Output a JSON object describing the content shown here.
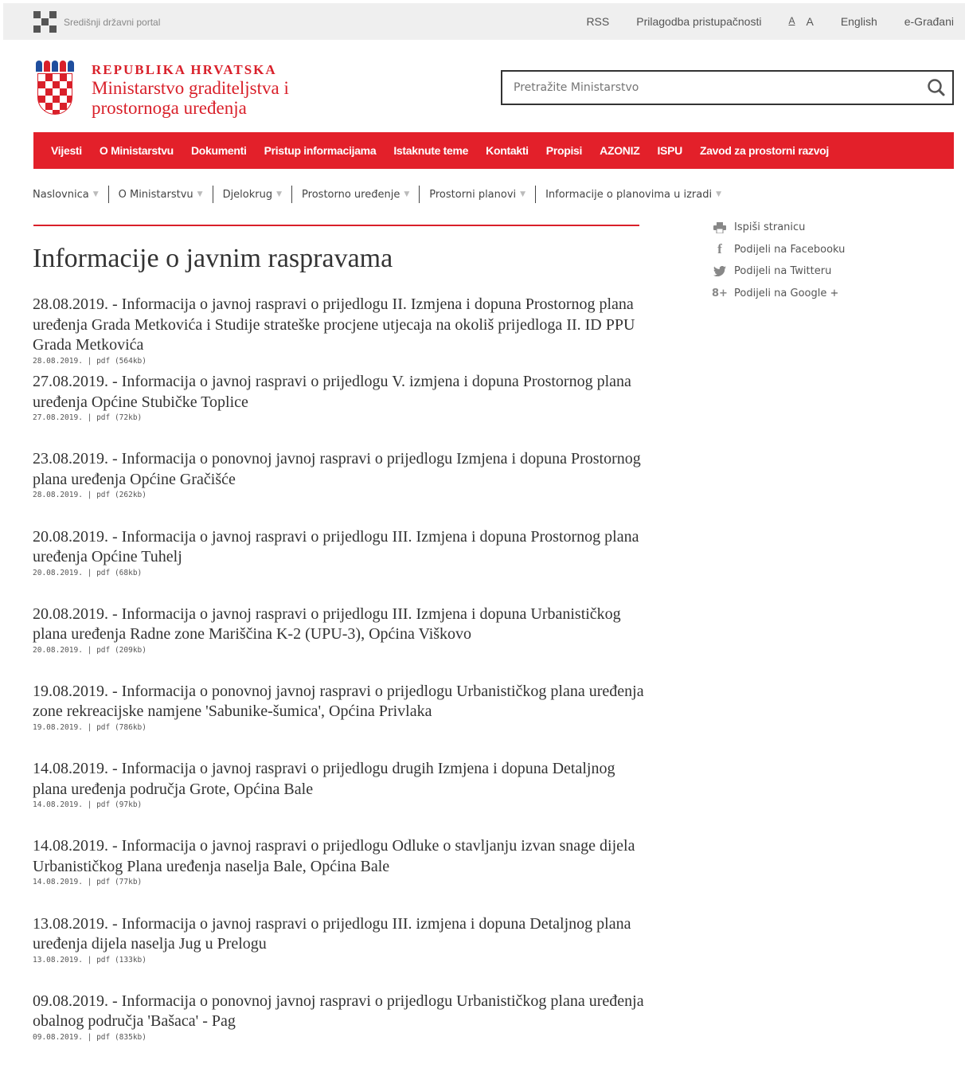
{
  "topbar": {
    "portal_name": "Središnji državni portal",
    "links": {
      "rss": "RSS",
      "accessibility": "Prilagodba pristupačnosti",
      "font_small": "A",
      "font_large": "A",
      "english": "English",
      "egradjani": "e-Građani"
    }
  },
  "header": {
    "republic": "REPUBLIKA HRVATSKA",
    "ministry": "Ministarstvo graditeljstva i prostornoga uređenja",
    "search_placeholder": "Pretražite Ministarstvo"
  },
  "nav": {
    "items": [
      "Vijesti",
      "O Ministarstvu",
      "Dokumenti",
      "Pristup informacijama",
      "Istaknute teme",
      "Kontakti",
      "Propisi",
      "AZONIZ",
      "ISPU",
      "Zavod za prostorni razvoj"
    ]
  },
  "breadcrumb": [
    "Naslovnica",
    "O Ministarstvu",
    "Djelokrug",
    "Prostorno uređenje",
    "Prostorni planovi",
    "Informacije o planovima u izradi"
  ],
  "page": {
    "title": "Informacije o javnim raspravama"
  },
  "items": [
    {
      "text": "28.08.2019. - Informacija o javnoj raspravi o prijedlogu II. Izmjena i dopuna Prostornog plana uređenja Grada Metkovića i Studije strateške procjene utjecaja na okoliš prijedloga II. ID PPU Grada Metkovića",
      "meta": "28.08.2019. | pdf (564kb)"
    },
    {
      "text": "27.08.2019. - Informacija o javnoj raspravi o prijedlogu V. izmjena i dopuna Prostornog plana uređenja Općine Stubičke Toplice",
      "meta": "27.08.2019. | pdf (72kb)"
    },
    {
      "text": "23.08.2019. - Informacija o ponovnoj javnoj raspravi o prijedlogu Izmjena i dopuna Prostornog plana uređenja Općine Gračišće",
      "meta": "28.08.2019. | pdf (262kb)"
    },
    {
      "text": "20.08.2019. - Informacija o javnoj raspravi o prijedlogu III. Izmjena i dopuna Prostornog plana uređenja Općine Tuhelj",
      "meta": "20.08.2019. | pdf (68kb)"
    },
    {
      "text": "20.08.2019. - Informacija o javnoj raspravi o prijedlogu III. Izmjena i dopuna Urbanističkog plana uređenja Radne zone Mariščina K-2 (UPU-3), Općina Viškovo",
      "meta": "20.08.2019. | pdf (209kb)"
    },
    {
      "text": "19.08.2019. - Informacija o ponovnoj javnoj raspravi o prijedlogu Urbanističkog plana uređenja zone rekreacijske namjene 'Sabunike-šumica', Općina Privlaka",
      "meta": "19.08.2019. | pdf (786kb)"
    },
    {
      "text": "14.08.2019. - Informacija o javnoj raspravi o prijedlogu drugih Izmjena i dopuna Detaljnog plana uređenja područja Grote, Općina Bale",
      "meta": "14.08.2019. | pdf (97kb)"
    },
    {
      "text": "14.08.2019. - Informacija o javnoj raspravi o prijedlogu Odluke o stavljanju izvan snage dijela Urbanističkog Plana uređenja naselja Bale, Općina Bale",
      "meta": "14.08.2019. | pdf (77kb)"
    },
    {
      "text": "13.08.2019. - Informacija o javnoj raspravi o prijedlogu III. izmjena i dopuna Detaljnog plana uređenja dijela naselja Jug u Prelogu",
      "meta": "13.08.2019. | pdf (133kb)"
    },
    {
      "text": "09.08.2019. - Informacija o ponovnoj javnoj raspravi o prijedlogu Urbanističkog plana uređenja obalnog područja 'Bašaca' - Pag",
      "meta": "09.08.2019. | pdf (835kb)"
    }
  ],
  "share": {
    "print": "Ispiši stranicu",
    "facebook": "Podijeli na Facebooku",
    "twitter": "Podijeli na Twitteru",
    "google": "Podijeli na Google +",
    "google_icon_text": "8+"
  },
  "colors": {
    "brand_red": "#e3202a",
    "topbar_bg": "#efefef"
  }
}
